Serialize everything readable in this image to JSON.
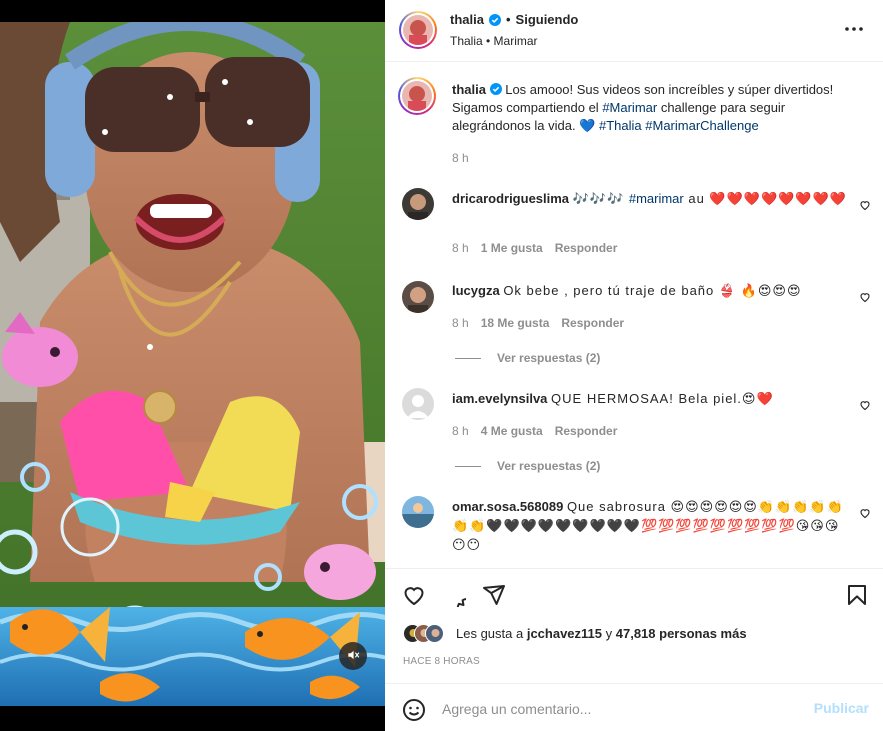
{
  "post": {
    "username": "thalia",
    "follow_status": "Siguiendo",
    "location_line": "Thalia • Marimar",
    "more_options_icon": "more-horizontal-icon"
  },
  "caption": {
    "username": "thalia",
    "text_main": "Los amooo! Sus videos son increíbles y súper divertidos! Sigamos compartiendo el ",
    "tag1": "#Marimar",
    "text_mid": " challenge para seguir alegrándonos la vida. 💙 ",
    "tag2": "#Thalia",
    "tag3": "#MarimarChallenge",
    "time": "8 h"
  },
  "comments": [
    {
      "username": "dricarodrigueslima",
      "text_emoji": "🎶🎶🎶 ",
      "tag": "#marimar",
      "text_rest": " au ❤️❤️❤️❤️❤️❤️❤️❤️",
      "time": "8 h",
      "likes": "1 Me gusta",
      "reply": "Responder"
    },
    {
      "username": "lucygza",
      "text": "Ok bebe , pero tú traje de baño 👙 🔥😍😍😍",
      "time": "8 h",
      "likes": "18 Me gusta",
      "reply": "Responder",
      "view_replies": "Ver respuestas (2)"
    },
    {
      "username": "iam.evelynsilva",
      "text": "QUE HERMOSAA! Bela piel.😍❤️",
      "time": "8 h",
      "likes": "4 Me gusta",
      "reply": "Responder",
      "view_replies": "Ver respuestas (2)"
    },
    {
      "username": "omar.sosa.568089",
      "text": "Que sabrosura 😍😍😍😍😍😍👏👏👏👏👏👏👏🖤🖤🖤🖤🖤🖤🖤🖤🖤💯💯💯💯💯💯💯💯💯😘😘😘😶😶"
    }
  ],
  "actions": {
    "like_icon": "heart-icon",
    "comment_icon": "comment-icon",
    "share_icon": "share-icon",
    "save_icon": "bookmark-icon"
  },
  "likes": {
    "prefix": "Les gusta a ",
    "user": "jcchavez115",
    "middle": " y ",
    "count": "47,818 personas más"
  },
  "posted_ago": "HACE 8 HORAS",
  "add_comment": {
    "placeholder": "Agrega un comentario...",
    "post_label": "Publicar",
    "emoji_icon": "smiley-icon"
  },
  "colors": {
    "link": "#00376b",
    "secondary_text": "#8e8e8e",
    "publish_disabled": "#b2dffc",
    "verified": "#0095f6"
  }
}
